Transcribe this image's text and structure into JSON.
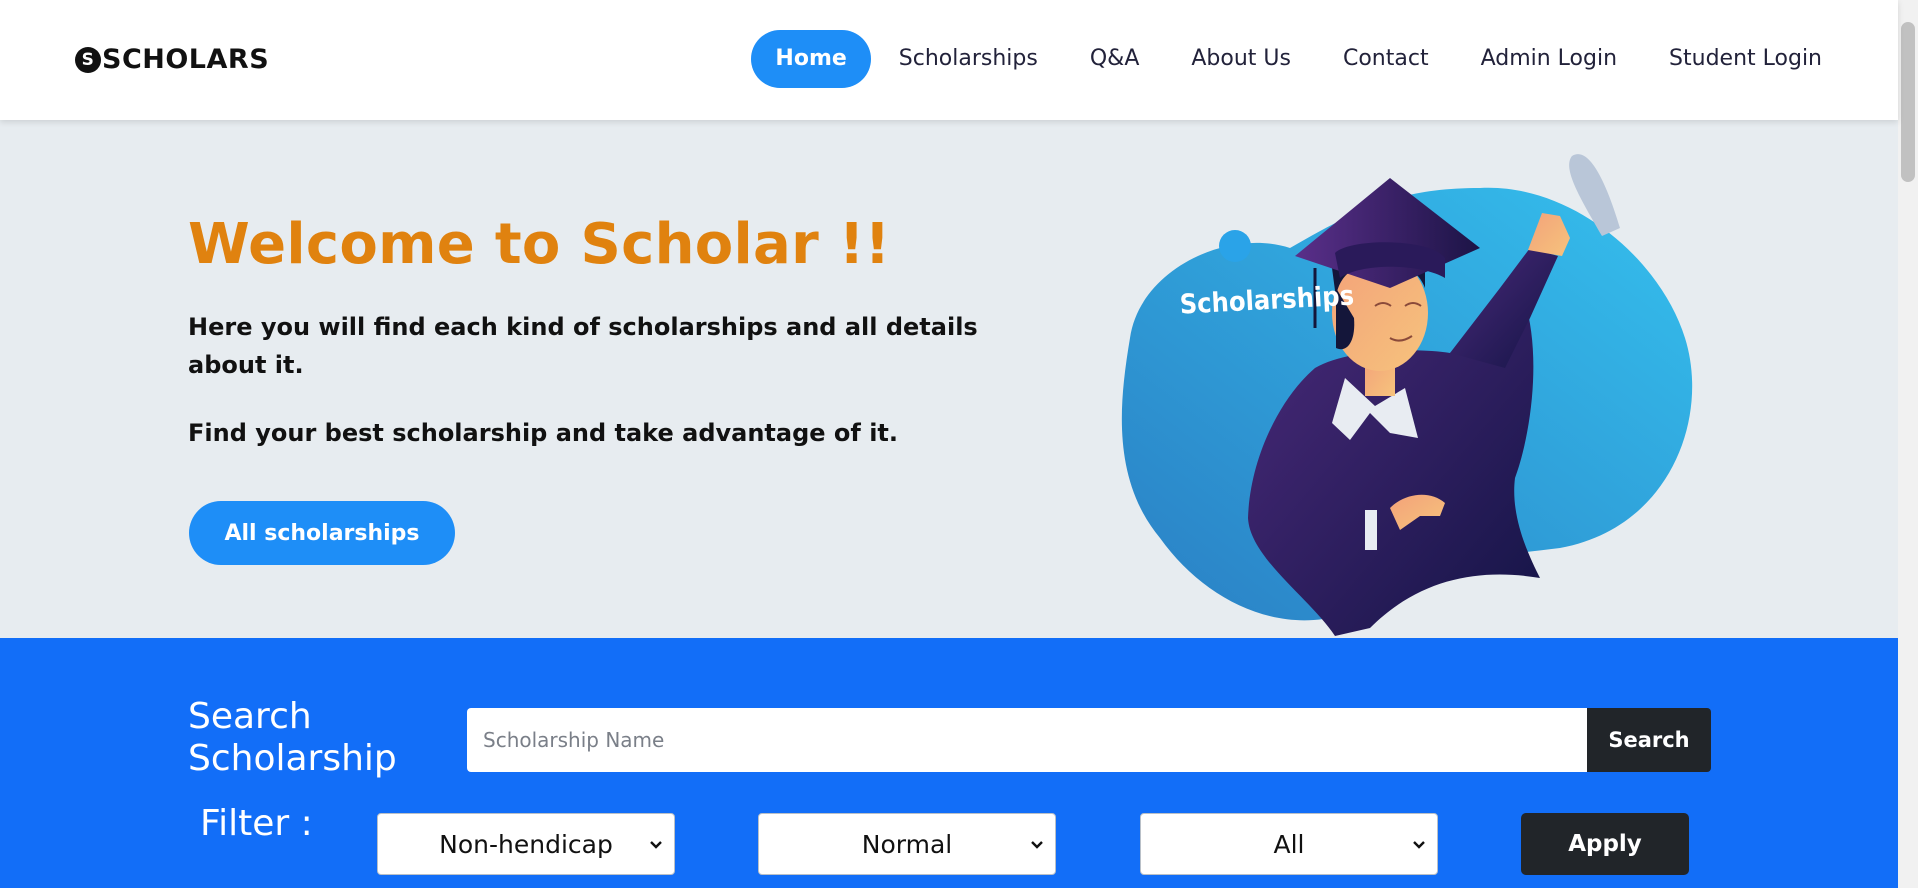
{
  "brand": {
    "mark": "S",
    "name": "SCHOLARS"
  },
  "nav": {
    "items": [
      {
        "label": "Home"
      },
      {
        "label": "Scholarships"
      },
      {
        "label": "Q&A"
      },
      {
        "label": "About Us"
      },
      {
        "label": "Contact"
      },
      {
        "label": "Admin Login"
      },
      {
        "label": "Student Login"
      }
    ]
  },
  "hero": {
    "title": "Welcome to Scholar !!",
    "paragraph1": "Here you will find each kind of scholarships and all details about it.",
    "paragraph2": "Find your best scholarship and take advantage of it.",
    "button": "All scholarships",
    "illustration_label": "Scholarships"
  },
  "search": {
    "title_line1": "Search",
    "title_line2": "Scholarship",
    "placeholder": "Scholarship Name",
    "button": "Search",
    "filter_label": "Filter :",
    "filters": [
      "Non-hendicap",
      "Normal",
      "All"
    ],
    "apply": "Apply"
  },
  "colors": {
    "accent": "#1e8ef7",
    "title": "#e0820f",
    "search_bg": "#126ef8",
    "dark_button": "#212529"
  }
}
